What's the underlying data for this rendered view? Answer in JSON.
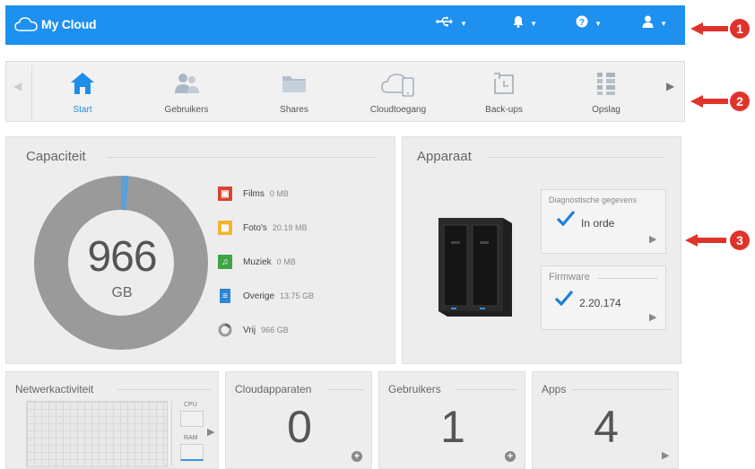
{
  "header": {
    "title": "My Cloud",
    "usb_icon": "usb-icon",
    "bell_icon": "bell-icon",
    "help_icon": "help-icon",
    "user_icon": "user-icon"
  },
  "nav": {
    "items": [
      {
        "label": "Start",
        "icon": "home-icon",
        "active": true
      },
      {
        "label": "Gebruikers",
        "icon": "users-icon"
      },
      {
        "label": "Shares",
        "icon": "folder-icon"
      },
      {
        "label": "Cloudtoegang",
        "icon": "cloud-device-icon"
      },
      {
        "label": "Back-ups",
        "icon": "backup-icon"
      },
      {
        "label": "Opslag",
        "icon": "storage-icon"
      }
    ]
  },
  "capacity": {
    "title": "Capaciteit",
    "total_value": "966",
    "total_unit": "GB",
    "legend": [
      {
        "name": "Films",
        "value": "0 MB",
        "color": "#d9443a"
      },
      {
        "name": "Foto's",
        "value": "20.19 MB",
        "color": "#f2b431"
      },
      {
        "name": "Muziek",
        "value": "0 MB",
        "color": "#3ea546"
      },
      {
        "name": "Overige",
        "value": "13.75 GB",
        "color": "#2e87d6"
      },
      {
        "name": "Vrij",
        "value": "966 GB",
        "color": "#9a9a9a"
      }
    ],
    "used_fraction": 0.014
  },
  "device": {
    "title": "Apparaat",
    "diagnostics": {
      "title": "Diagnostische gegevens",
      "status": "In orde"
    },
    "firmware": {
      "title": "Firmware",
      "version": "2.20.174"
    }
  },
  "tiles": {
    "network": {
      "title": "Netwerkactiviteit",
      "cpu_label": "CPU",
      "ram_label": "RAM"
    },
    "cloud_devices": {
      "title": "Cloudapparaten",
      "value": "0"
    },
    "users": {
      "title": "Gebruikers",
      "value": "1"
    },
    "apps": {
      "title": "Apps",
      "value": "4"
    }
  },
  "callouts": [
    "1",
    "2",
    "3"
  ],
  "colors": {
    "header": "#1e90f0",
    "accent": "#1e8ee8",
    "callout": "#e0332b",
    "donut_free": "#9a9a9a",
    "donut_used": "#5aa0dc"
  }
}
